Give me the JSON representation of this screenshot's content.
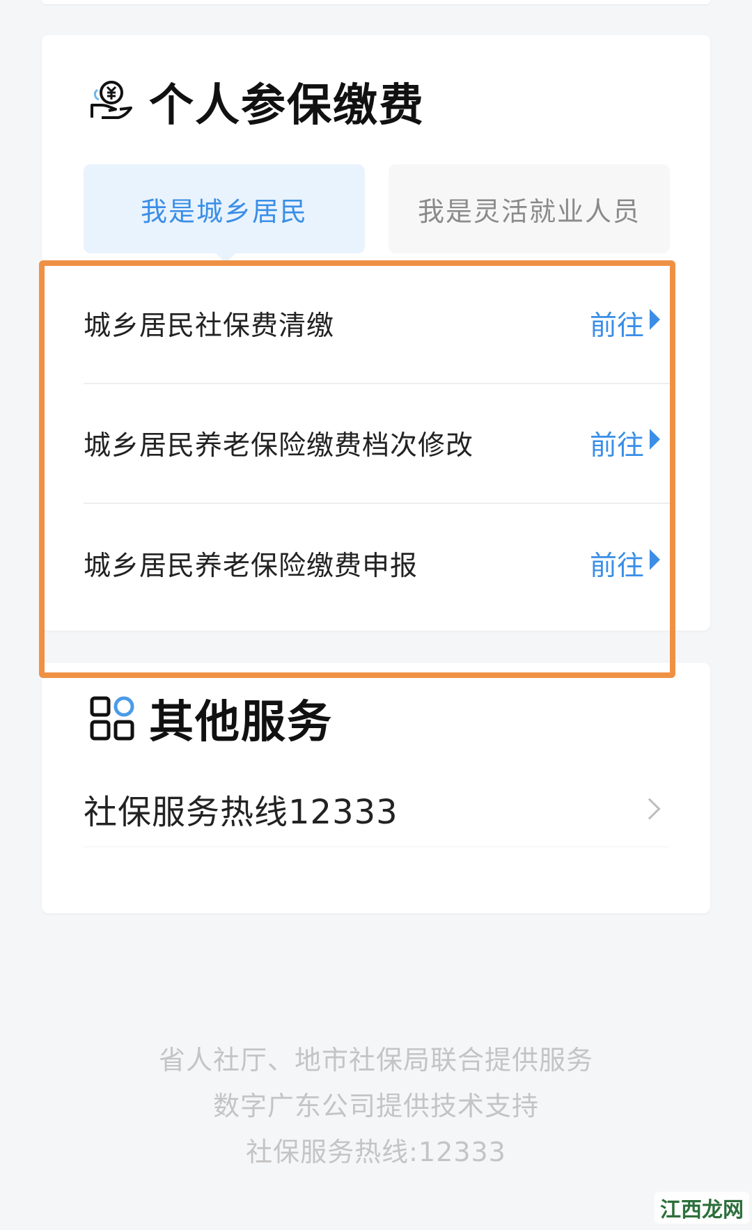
{
  "fees_section": {
    "title": "个人参保缴费",
    "icon": "hand-coin-icon",
    "tabs": [
      {
        "label": "我是城乡居民",
        "active": true
      },
      {
        "label": "我是灵活就业人员",
        "active": false
      }
    ],
    "items": [
      {
        "label": "城乡居民社保费清缴",
        "action": "前往"
      },
      {
        "label": "城乡居民养老保险缴费档次修改",
        "action": "前往"
      },
      {
        "label": "城乡居民养老保险缴费申报",
        "action": "前往"
      }
    ]
  },
  "other_section": {
    "title": "其他服务",
    "icon": "grid-apps-icon",
    "items": [
      {
        "label": "社保服务热线12333"
      }
    ]
  },
  "footer": {
    "line1": "省人社厅、地市社保局联合提供服务",
    "line2": "数字广东公司提供技术支持",
    "line3": "社保服务热线:12333"
  },
  "watermark": "江西龙网",
  "colors": {
    "accent": "#3a8ee6",
    "highlight": "#ef9145",
    "tab_active_bg": "#e9f3fd"
  }
}
